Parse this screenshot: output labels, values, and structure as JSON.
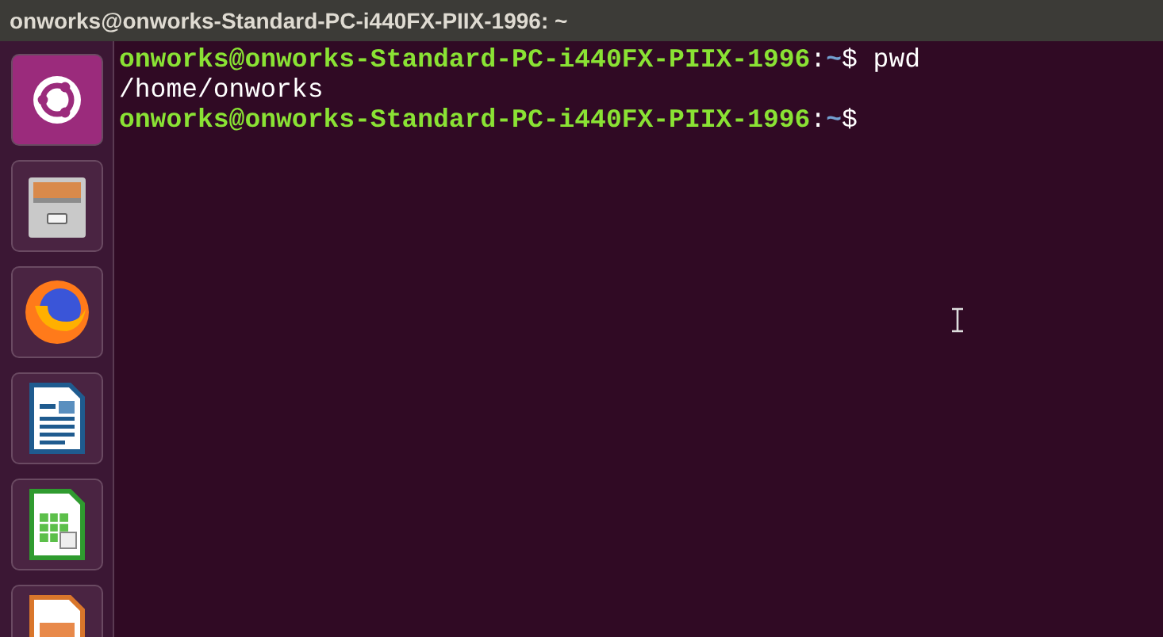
{
  "window": {
    "title": "onworks@onworks-Standard-PC-i440FX-PIIX-1996: ~"
  },
  "terminal": {
    "lines": [
      {
        "kind": "prompt",
        "user_host": "onworks@onworks-Standard-PC-i440FX-PIIX-1996",
        "separator": ":",
        "cwd": "~",
        "prompt_char": "$",
        "command": " pwd"
      },
      {
        "kind": "output",
        "text": "/home/onworks"
      },
      {
        "kind": "prompt",
        "user_host": "onworks@onworks-Standard-PC-i440FX-PIIX-1996",
        "separator": ":",
        "cwd": "~",
        "prompt_char": "$"
      }
    ]
  }
}
